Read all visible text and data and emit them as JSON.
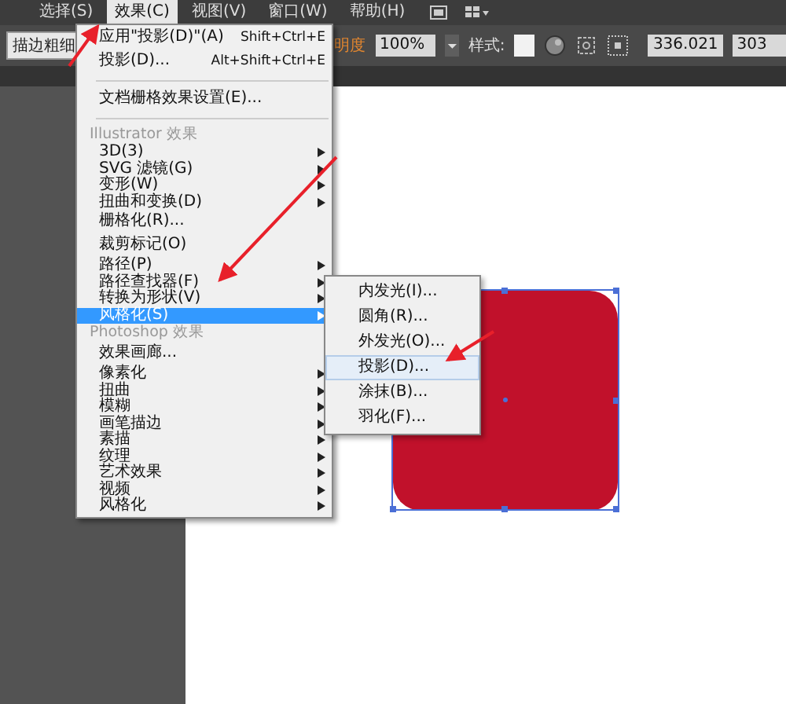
{
  "menubar": {
    "items": [
      {
        "label": "选择(S)",
        "selected": false
      },
      {
        "label": "效果(C)",
        "selected": true
      },
      {
        "label": "视图(V)",
        "selected": false
      },
      {
        "label": "窗口(W)",
        "selected": false
      },
      {
        "label": "帮助(H)",
        "selected": false
      }
    ]
  },
  "tooltip": "描边粗细",
  "control_bar": {
    "opacity_label": "明度",
    "opacity": "100%",
    "style_label": "样式:",
    "x_value": "336.021",
    "y_value": "303"
  },
  "menu": {
    "items": [
      {
        "kind": "item",
        "label": "应用\"投影(D)\"(A)",
        "shortcut": "Shift+Ctrl+E",
        "selected": false
      },
      {
        "kind": "item",
        "label": "投影(D)...",
        "shortcut": "Alt+Shift+Ctrl+E",
        "selected": false
      },
      {
        "kind": "separator"
      },
      {
        "kind": "item",
        "label": "文档栅格效果设置(E)...",
        "selected": false
      },
      {
        "kind": "separator"
      },
      {
        "kind": "header",
        "label": "Illustrator 效果"
      },
      {
        "kind": "submenu",
        "label": "3D(3)",
        "selected": false
      },
      {
        "kind": "submenu",
        "label": "SVG 滤镜(G)",
        "selected": false
      },
      {
        "kind": "submenu",
        "label": "变形(W)",
        "selected": false
      },
      {
        "kind": "submenu",
        "label": "扭曲和变换(D)",
        "selected": false
      },
      {
        "kind": "item",
        "label": "栅格化(R)...",
        "selected": false
      },
      {
        "kind": "item",
        "label": "裁剪标记(O)",
        "selected": false
      },
      {
        "kind": "submenu",
        "label": "路径(P)",
        "selected": false
      },
      {
        "kind": "submenu",
        "label": "路径查找器(F)",
        "selected": false
      },
      {
        "kind": "submenu",
        "label": "转换为形状(V)",
        "selected": false
      },
      {
        "kind": "submenu",
        "label": "风格化(S)",
        "selected": true
      },
      {
        "kind": "header",
        "label": "Photoshop 效果"
      },
      {
        "kind": "item",
        "label": "效果画廊...",
        "selected": false
      },
      {
        "kind": "submenu",
        "label": "像素化",
        "selected": false
      },
      {
        "kind": "submenu",
        "label": "扭曲",
        "selected": false
      },
      {
        "kind": "submenu",
        "label": "模糊",
        "selected": false
      },
      {
        "kind": "submenu",
        "label": "画笔描边",
        "selected": false
      },
      {
        "kind": "submenu",
        "label": "素描",
        "selected": false
      },
      {
        "kind": "submenu",
        "label": "纹理",
        "selected": false
      },
      {
        "kind": "submenu",
        "label": "艺术效果",
        "selected": false
      },
      {
        "kind": "submenu",
        "label": "视频",
        "selected": false
      },
      {
        "kind": "submenu",
        "label": "风格化",
        "selected": false
      }
    ]
  },
  "submenu": {
    "items": [
      {
        "label": "内发光(I)...",
        "selected": false
      },
      {
        "label": "圆角(R)...",
        "selected": false
      },
      {
        "label": "外发光(O)...",
        "selected": false
      },
      {
        "label": "投影(D)...",
        "selected": true
      },
      {
        "label": "涂抹(B)...",
        "selected": false
      },
      {
        "label": "羽化(F)...",
        "selected": false
      }
    ]
  },
  "artboard": {
    "shape": {
      "color": "#c1112b",
      "selected": true
    }
  }
}
